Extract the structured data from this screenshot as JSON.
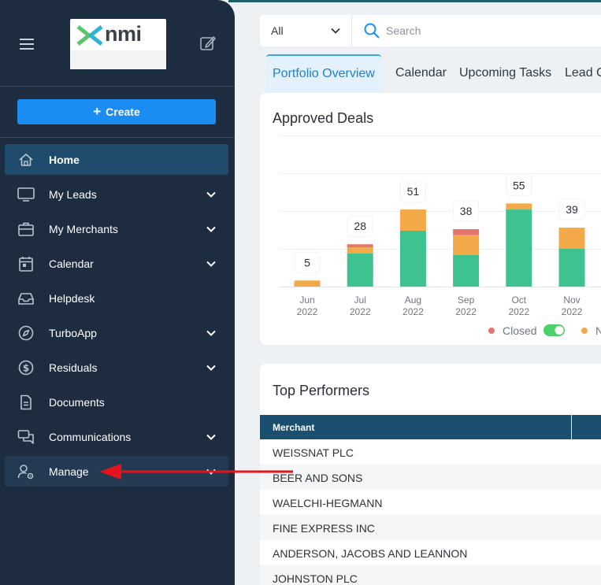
{
  "app": {
    "logo_text": "nmi",
    "create_label": "Create"
  },
  "colors": {
    "sidebar_bg": "#1d2c3f",
    "active_bg": "#1f4b6d",
    "create_button": "#1b8cf2",
    "closed": "#e8736c",
    "other": "#f2aa48",
    "approved_green": "#3ec28f",
    "table_header": "#1b4f6f"
  },
  "sidebar": {
    "items": [
      {
        "label": "Home",
        "icon": "home-icon",
        "active": true,
        "has_children": false
      },
      {
        "label": "My Leads",
        "icon": "monitor-icon",
        "active": false,
        "has_children": true
      },
      {
        "label": "My Merchants",
        "icon": "briefcase-icon",
        "active": false,
        "has_children": true
      },
      {
        "label": "Calendar",
        "icon": "calendar-icon",
        "active": false,
        "has_children": true
      },
      {
        "label": "Helpdesk",
        "icon": "inbox-icon",
        "active": false,
        "has_children": false
      },
      {
        "label": "TurboApp",
        "icon": "compass-icon",
        "active": false,
        "has_children": true
      },
      {
        "label": "Residuals",
        "icon": "dollar-icon",
        "active": false,
        "has_children": true
      },
      {
        "label": "Documents",
        "icon": "document-icon",
        "active": false,
        "has_children": false
      },
      {
        "label": "Communications",
        "icon": "chat-icon",
        "active": false,
        "has_children": true
      },
      {
        "label": "Manage",
        "icon": "user-gear-icon",
        "active": false,
        "has_children": true
      }
    ]
  },
  "search": {
    "scope_value": "All",
    "placeholder": "Search"
  },
  "tabs": [
    {
      "label": "Portfolio Overview",
      "active": true
    },
    {
      "label": "Calendar",
      "active": false
    },
    {
      "label": "Upcoming Tasks",
      "active": false
    },
    {
      "label": "Lead C",
      "active": false
    }
  ],
  "approved_deals": {
    "title": "Approved Deals",
    "legend": [
      {
        "label": "Closed",
        "color": "#e8736c",
        "toggle_on": true
      },
      {
        "label": "N",
        "color": "#f2aa48"
      }
    ]
  },
  "chart_data": {
    "type": "bar",
    "title": "Approved Deals",
    "categories": [
      "Jun 2022",
      "Jul 2022",
      "Aug 2022",
      "Sep 2022",
      "Oct 2022",
      "Nov 2022"
    ],
    "category_lines": [
      [
        "Jun",
        "2022"
      ],
      [
        "Jul",
        "2022"
      ],
      [
        "Aug",
        "2022"
      ],
      [
        "Sep",
        "2022"
      ],
      [
        "Oct",
        "2022"
      ],
      [
        "Nov",
        "2022"
      ]
    ],
    "totals": [
      5,
      28,
      51,
      38,
      55,
      39
    ],
    "series": [
      {
        "name": "",
        "color": "#3ec28f",
        "values": [
          0,
          22,
          37,
          21,
          51,
          25
        ]
      },
      {
        "name": "",
        "color": "#f2aa48",
        "values": [
          4,
          4,
          14,
          13,
          4,
          14
        ]
      },
      {
        "name": "Closed",
        "color": "#e8736c",
        "values": [
          0,
          2,
          0,
          4,
          0,
          0
        ]
      }
    ],
    "ylim": [
      0,
      100
    ],
    "stacked": true,
    "grid": true
  },
  "top_performers": {
    "title": "Top Performers",
    "column_merchant": "Merchant",
    "rows": [
      "WEISSNAT PLC",
      "BEER AND SONS",
      "WAELCHI-HEGMANN",
      "FINE EXPRESS INC",
      "ANDERSON, JACOBS AND LEANNON",
      "JOHNSTON PLC"
    ]
  }
}
